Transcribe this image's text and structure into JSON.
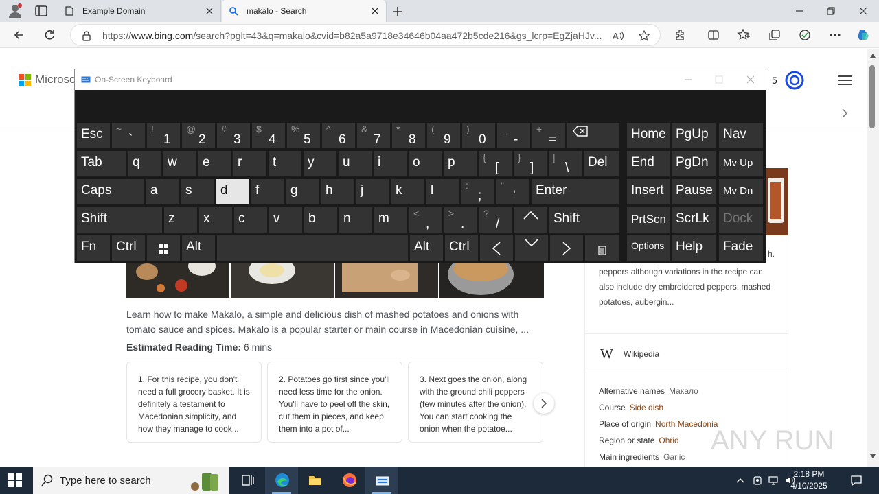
{
  "browser": {
    "tabs": [
      {
        "title": "Example Domain"
      },
      {
        "title": "makalo - Search"
      }
    ],
    "url_prefix": "https://",
    "url_host": "www.bing.com",
    "url_rest": "/search?pglt=43&q=makalo&cvid=b82a5a9718e34646b04aa472b5cde216&gs_lcrp=EgZjaHJv..."
  },
  "page": {
    "brand": "Microsoft",
    "rewards_points": "5",
    "snippet": "Learn how to make Makalo, a simple and delicious dish of mashed potatoes and onions with tomato sauce and spices. Makalo is a popular starter or main course in Macedonian cuisine, ...",
    "reading_label": "Estimated Reading Time:",
    "reading_value": "6 mins",
    "steps": [
      "1. For this recipe, you don't need a full grocery basket. It is definitely a testament to Macedonian simplicity, and how they manage to cook...",
      "2. Potatoes go first since you'll need less time for the onion. You'll have to peel off the skin, cut them in pieces, and keep them into a pot of...",
      "3. Next goes the onion, along with the ground chili peppers (few minutes after the onion). You can start cooking the onion when the potatoe..."
    ],
    "side": {
      "desc_top": "h.",
      "desc": "The main ingredients include oil, garlic and peppers although variations in the recipe can also include dry embroidered peppers, mashed potatoes, aubergin...",
      "wiki_label": "Wikipedia",
      "facts": [
        {
          "key": "Alternative names",
          "value": "Макало",
          "link": false
        },
        {
          "key": "Course",
          "value": "Side dish",
          "link": true
        },
        {
          "key": "Place of origin",
          "value": "North Macedonia",
          "link": true
        },
        {
          "key": "Region or state",
          "value": "Ohrid",
          "link": true
        },
        {
          "key": "Main ingredients",
          "value": "Garlic",
          "link": false
        }
      ]
    },
    "watermark": "ANY RUN"
  },
  "osk": {
    "title": "On-Screen Keyboard",
    "row1": [
      {
        "label": "Esc"
      },
      {
        "shift": "~",
        "base": "`"
      },
      {
        "shift": "!",
        "base": "1"
      },
      {
        "shift": "@",
        "base": "2"
      },
      {
        "shift": "#",
        "base": "3"
      },
      {
        "shift": "$",
        "base": "4"
      },
      {
        "shift": "%",
        "base": "5"
      },
      {
        "shift": "^",
        "base": "6"
      },
      {
        "shift": "&",
        "base": "7"
      },
      {
        "shift": "*",
        "base": "8"
      },
      {
        "shift": "(",
        "base": "9"
      },
      {
        "shift": ")",
        "base": "0"
      },
      {
        "shift": "_",
        "base": "-"
      },
      {
        "shift": "+",
        "base": "="
      }
    ],
    "row2": [
      "Tab",
      "q",
      "w",
      "e",
      "r",
      "t",
      "y",
      "u",
      "i",
      "o",
      "p"
    ],
    "row2b": [
      {
        "shift": "{",
        "base": "["
      },
      {
        "shift": "}",
        "base": "]"
      },
      {
        "shift": "|",
        "base": "\\"
      }
    ],
    "row2c": "Del",
    "row3": [
      "Caps",
      "a",
      "s",
      "d",
      "f",
      "g",
      "h",
      "j",
      "k",
      "l"
    ],
    "row3b": [
      {
        "shift": ":",
        "base": ";"
      },
      {
        "shift": "\"",
        "base": "'"
      }
    ],
    "row3c": "Enter",
    "row4": [
      "Shift",
      "z",
      "x",
      "c",
      "v",
      "b",
      "n",
      "m"
    ],
    "row4b": [
      {
        "shift": "<",
        "base": ","
      },
      {
        "shift": ">",
        "base": "."
      },
      {
        "shift": "?",
        "base": "/"
      }
    ],
    "row4c": "Shift",
    "row5": {
      "fn": "Fn",
      "ctrl": "Ctrl",
      "alt": "Alt",
      "alt2": "Alt",
      "ctrl2": "Ctrl"
    },
    "nav": {
      "r1": [
        "Home",
        "PgUp",
        "Nav"
      ],
      "r2": [
        "End",
        "PgDn",
        "Mv Up"
      ],
      "r3": [
        "Insert",
        "Pause",
        "Mv Dn"
      ],
      "r4": [
        "PrtScn",
        "ScrLk",
        "Dock"
      ],
      "r5": [
        "Options",
        "Help",
        "Fade"
      ]
    },
    "pressed_key": "d"
  },
  "taskbar": {
    "search_placeholder": "Type here to search",
    "time": "2:18 PM",
    "date": "4/10/2025"
  },
  "colors": {
    "osk_bg": "#1a1a1a",
    "key_bg": "#333333",
    "taskbar_bg": "#1c2a3a",
    "link_brown": "#8b4513"
  }
}
